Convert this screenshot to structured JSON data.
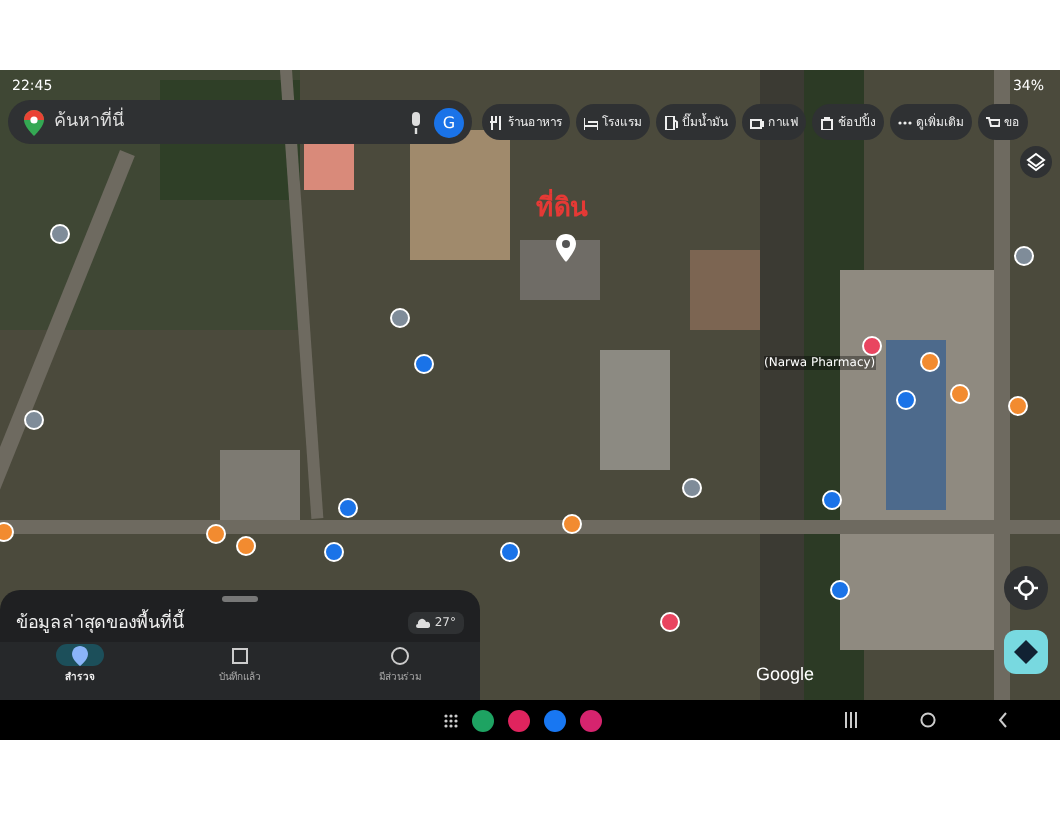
{
  "status_bar": {
    "time": "22:45",
    "battery": "34%"
  },
  "search": {
    "placeholder": "ค้นหาที่นี่",
    "account_initial": "G"
  },
  "chips": [
    {
      "label": "ร้านอาหาร",
      "kind": "restaurant"
    },
    {
      "label": "โรงแรม",
      "kind": "hotel"
    },
    {
      "label": "ปั๊มน้ำมัน",
      "kind": "gas"
    },
    {
      "label": "กาแฟ",
      "kind": "coffee"
    },
    {
      "label": "ช้อปปิ้ง",
      "kind": "shopping"
    },
    {
      "label": "ดูเพิ่มเติม",
      "kind": "more"
    },
    {
      "label": "ขอ",
      "kind": "cart"
    }
  ],
  "map": {
    "annotation": "ที่ดิน",
    "place_label": "(Narwa Pharmacy)",
    "attribution": "Google"
  },
  "sheet": {
    "title": "ข้อมูลล่าสุดของพื้นที่นี้",
    "weather": "27°"
  },
  "tabs": [
    {
      "label": "สำรวจ",
      "kind": "explore",
      "selected": true
    },
    {
      "label": "บันทึกแล้ว",
      "kind": "saved",
      "selected": false
    },
    {
      "label": "มีส่วนร่วม",
      "kind": "contribute",
      "selected": false
    }
  ]
}
